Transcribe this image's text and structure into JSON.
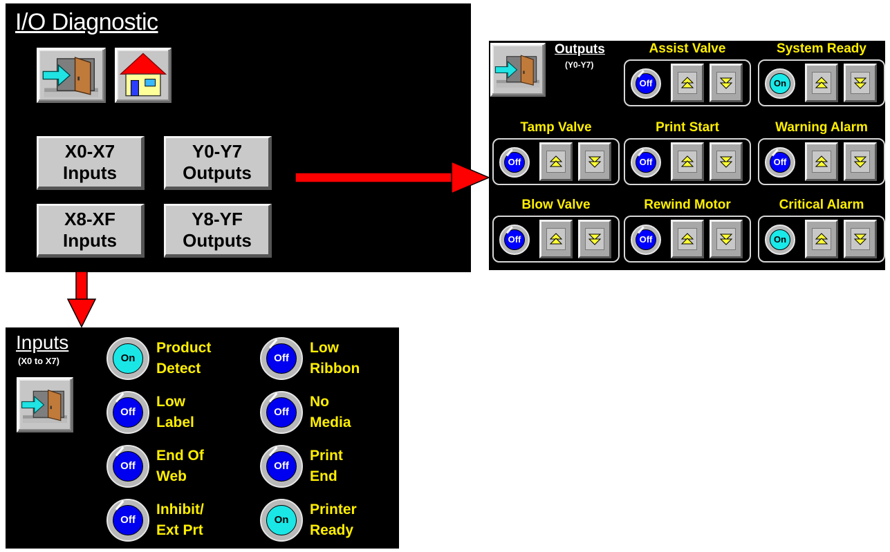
{
  "diagnostic": {
    "title": "I/O Diagnostic",
    "exit_icon": "exit-door-icon",
    "home_icon": "home-icon",
    "nav": [
      {
        "line1": "X0-X7",
        "line2": "Inputs"
      },
      {
        "line1": "Y0-Y7",
        "line2": "Outputs"
      },
      {
        "line1": "X8-XF",
        "line2": "Inputs"
      },
      {
        "line1": "Y8-YF",
        "line2": "Outputs"
      }
    ]
  },
  "outputs": {
    "title": "Outputs",
    "subtitle": "(Y0-Y7)",
    "items": [
      {
        "label": "Assist Valve",
        "state": "Off"
      },
      {
        "label": "System Ready",
        "state": "On"
      },
      {
        "label": "Tamp Valve",
        "state": "Off"
      },
      {
        "label": "Print Start",
        "state": "Off"
      },
      {
        "label": "Warning Alarm",
        "state": "Off"
      },
      {
        "label": "Blow Valve",
        "state": "Off"
      },
      {
        "label": "Rewind Motor",
        "state": "Off"
      },
      {
        "label": "Critical Alarm",
        "state": "On"
      }
    ]
  },
  "inputs": {
    "title": "Inputs",
    "subtitle": "(X0 to X7)",
    "items": [
      {
        "line1": "Product",
        "line2": "Detect",
        "state": "On"
      },
      {
        "line1": "Low",
        "line2": "Ribbon",
        "state": "Off"
      },
      {
        "line1": "Low",
        "line2": "Label",
        "state": "Off"
      },
      {
        "line1": "No",
        "line2": "Media",
        "state": "Off"
      },
      {
        "line1": "End Of",
        "line2": "Web",
        "state": "Off"
      },
      {
        "line1": "Print",
        "line2": "End",
        "state": "Off"
      },
      {
        "line1": "Inhibit/",
        "line2": "Ext Prt",
        "state": "Off"
      },
      {
        "line1": "Printer",
        "line2": "Ready",
        "state": "On"
      }
    ]
  },
  "colors": {
    "accent_label": "#ffef00",
    "indicator_on": "#19e9e9",
    "indicator_off": "#0000ff",
    "arrow": "#ff0000"
  }
}
